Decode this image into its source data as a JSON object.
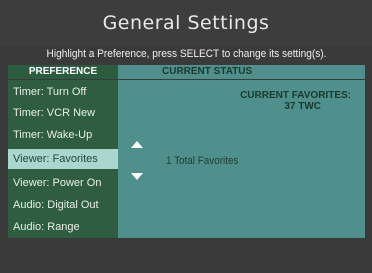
{
  "title": "General Settings",
  "subtitle": "Highlight a Preference, press SELECT to change its setting(s).",
  "columns": {
    "preference": "PREFERENCE",
    "current_status": "CURRENT STATUS"
  },
  "preferences": [
    {
      "label": "Timer: Turn Off",
      "selected": false
    },
    {
      "label": "Timer: VCR New",
      "selected": false
    },
    {
      "label": "Timer: Wake-Up",
      "selected": false
    },
    {
      "label": "Viewer: Favorites",
      "selected": true
    },
    {
      "label": "Viewer: Power On",
      "selected": false
    },
    {
      "label": "Audio: Digital Out",
      "selected": false
    },
    {
      "label": "Audio: Range",
      "selected": false
    }
  ],
  "status": {
    "favorites_label": "CURRENT FAVORITES:",
    "favorites_value": "37 TWC",
    "total": "1 Total Favorites"
  },
  "icons": {
    "scroll_up": "up-arrow-icon",
    "scroll_down": "down-arrow-icon"
  },
  "colors": {
    "highlight": "#a9d6cf",
    "list_background": "#2e5e3f",
    "status_background": "#4f8f8c"
  }
}
